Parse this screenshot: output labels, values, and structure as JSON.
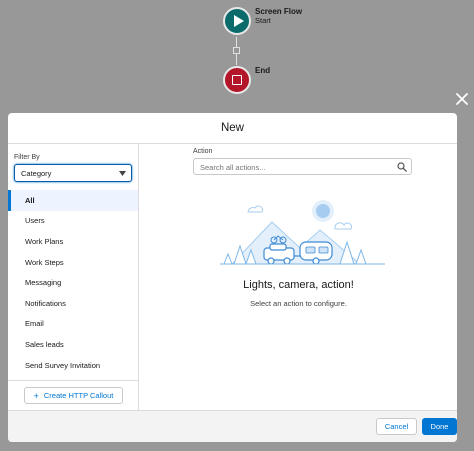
{
  "flow": {
    "start_title": "Screen Flow",
    "start_subtitle": "Start",
    "end_label": "End"
  },
  "modal": {
    "title": "New",
    "filter": {
      "label": "Filter By",
      "selected": "Category"
    },
    "nav_items": [
      {
        "label": "All",
        "active": true
      },
      {
        "label": "Users"
      },
      {
        "label": "Work Plans"
      },
      {
        "label": "Work Steps"
      },
      {
        "label": "Messaging"
      },
      {
        "label": "Notifications"
      },
      {
        "label": "Email"
      },
      {
        "label": "Sales leads"
      },
      {
        "label": "Send Survey Invitation"
      }
    ],
    "http_callout_label": "Create HTTP Callout",
    "action": {
      "label": "Action",
      "placeholder": "Search all actions...",
      "value": ""
    },
    "empty_state": {
      "title": "Lights, camera, action!",
      "subtitle": "Select an action to configure."
    },
    "footer": {
      "cancel_label": "Cancel",
      "done_label": "Done"
    }
  },
  "colors": {
    "brand": "#0176d3",
    "start_node": "#0b6b6b",
    "end_node": "#b21628",
    "backdrop": "#989898"
  },
  "icons": [
    "play-icon",
    "stop-icon",
    "close-icon",
    "chevron-down-icon",
    "search-icon",
    "plus-icon"
  ]
}
